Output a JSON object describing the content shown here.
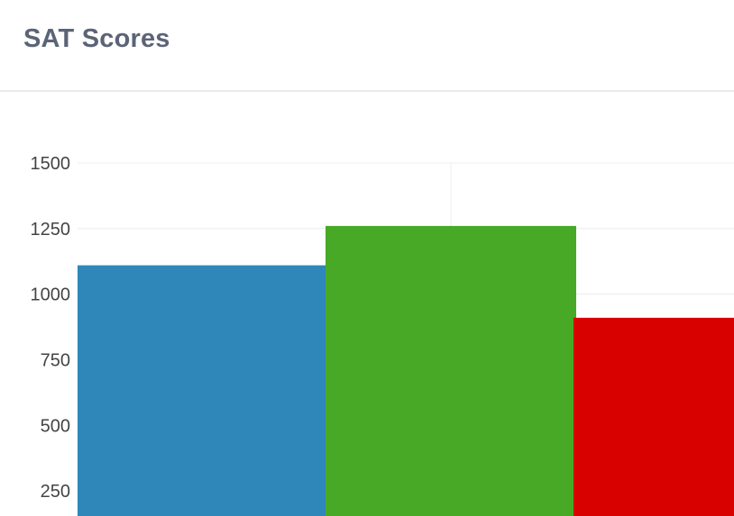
{
  "header": {
    "title": "SAT Scores"
  },
  "chart_data": {
    "type": "bar",
    "title": "SAT Scores",
    "xlabel": "",
    "ylabel": "",
    "categories": [
      "",
      "",
      ""
    ],
    "values": [
      1110,
      1260,
      910
    ],
    "colors": [
      "#2e87b8",
      "#48a926",
      "#d90000"
    ],
    "y_ticks": [
      "250",
      "500",
      "750",
      "1000",
      "1250",
      "1500"
    ],
    "ylim": [
      0,
      1500
    ],
    "grid": true
  }
}
